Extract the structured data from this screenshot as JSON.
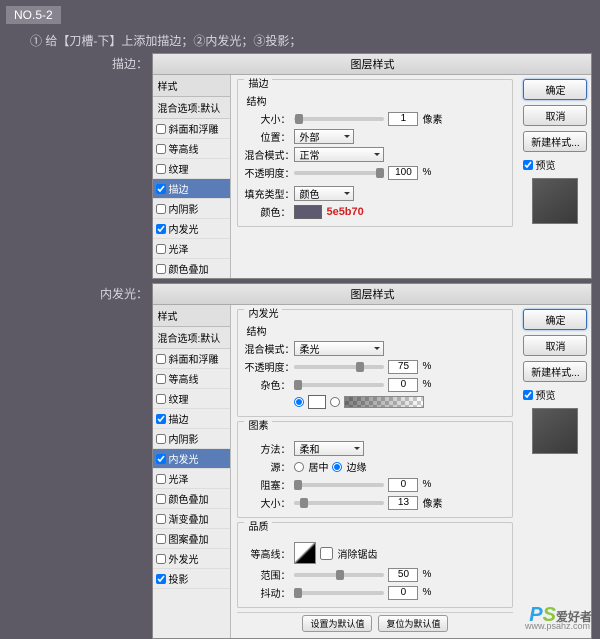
{
  "tag": "NO.5-2",
  "instruction": "① 给【刀槽-下】上添加描边；②内发光；③投影；",
  "section1_label": "描边：",
  "section2_label": "内发光：",
  "dialog_title": "图层样式",
  "styles_header": "样式",
  "blend_default": "混合选项:默认",
  "style_items": [
    "斜面和浮雕",
    "等高线",
    "纹理",
    "描边",
    "内阴影",
    "内发光",
    "光泽",
    "颜色叠加",
    "渐变叠加",
    "图案叠加",
    "外发光",
    "投影"
  ],
  "buttons": {
    "ok": "确定",
    "cancel": "取消",
    "new": "新建样式...",
    "preview": "预览"
  },
  "stroke": {
    "group1": "描边",
    "sub1": "结构",
    "size_lbl": "大小：",
    "size_val": "1",
    "size_unit": "像素",
    "pos_lbl": "位置：",
    "pos_val": "外部",
    "blend_lbl": "混合模式：",
    "blend_val": "正常",
    "opacity_lbl": "不透明度：",
    "opacity_val": "100",
    "pct": "%",
    "filltype_lbl": "填充类型：",
    "filltype_val": "颜色",
    "color_lbl": "颜色：",
    "hex": "5e5b70"
  },
  "inner": {
    "group1": "内发光",
    "sub1": "结构",
    "blend_lbl": "混合模式：",
    "blend_val": "柔光",
    "opacity_lbl": "不透明度：",
    "opacity_val": "75",
    "pct": "%",
    "noise_lbl": "杂色：",
    "noise_val": "0",
    "group2": "图素",
    "method_lbl": "方法：",
    "method_val": "柔和",
    "source_lbl": "源：",
    "src_center": "居中",
    "src_edge": "边缘",
    "choke_lbl": "阻塞：",
    "choke_val": "0",
    "size_lbl": "大小：",
    "size_val": "13",
    "size_unit": "像素",
    "group3": "品质",
    "contour_lbl": "等高线：",
    "anti_lbl": "消除锯齿",
    "range_lbl": "范围：",
    "range_val": "50",
    "jitter_lbl": "抖动：",
    "jitter_val": "0"
  },
  "bottom": {
    "b1": "设置为默认值",
    "b2": "复位为默认值"
  },
  "watermark": {
    "p": "P",
    "s": "S",
    "txt": "爱好者",
    "url": "www.psahz.com"
  }
}
